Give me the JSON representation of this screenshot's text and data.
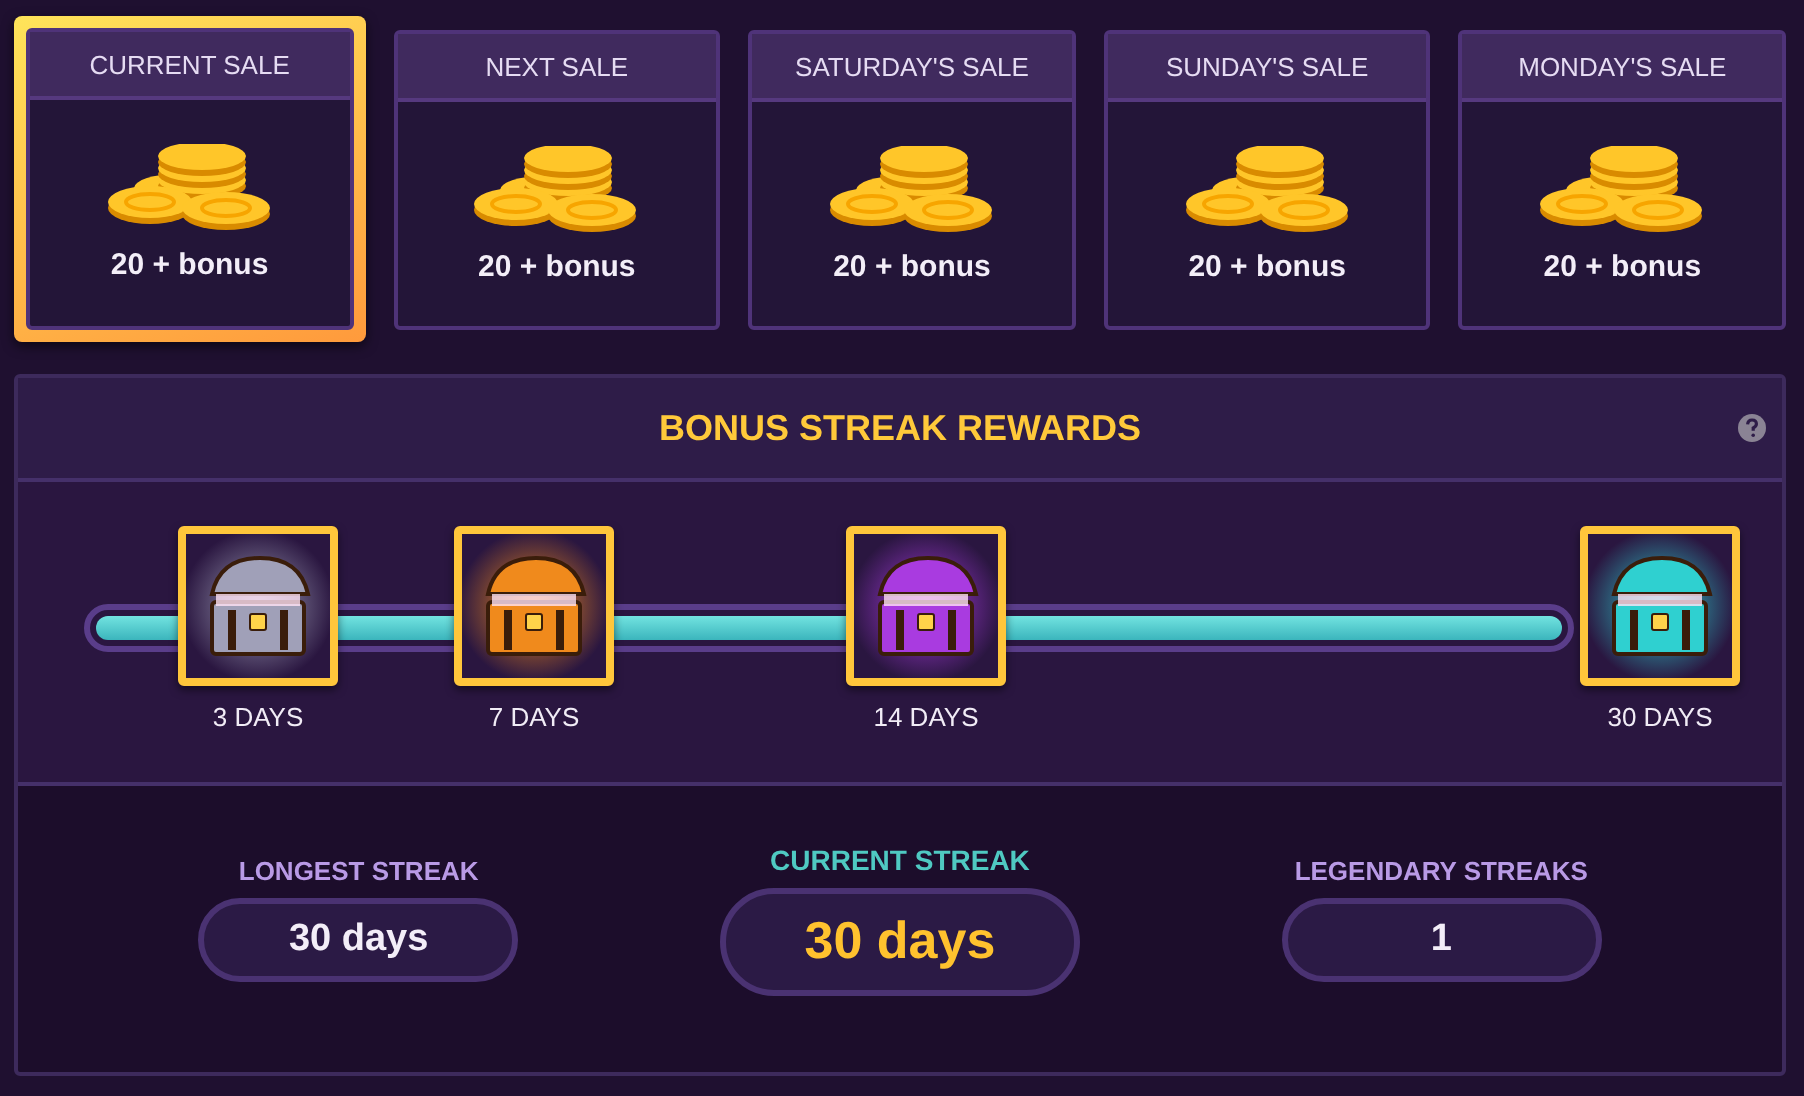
{
  "sales": [
    {
      "title": "CURRENT SALE",
      "amount": "20 + bonus",
      "selected": true
    },
    {
      "title": "NEXT SALE",
      "amount": "20 + bonus",
      "selected": false
    },
    {
      "title": "SATURDAY'S SALE",
      "amount": "20 + bonus",
      "selected": false
    },
    {
      "title": "SUNDAY'S SALE",
      "amount": "20 + bonus",
      "selected": false
    },
    {
      "title": "MONDAY'S SALE",
      "amount": "20 + bonus",
      "selected": false
    }
  ],
  "streak_panel": {
    "title": "BONUS STREAK REWARDS",
    "progress": {
      "level": 1
    },
    "milestones": [
      {
        "label": "3 DAYS",
        "color": "#a0a0b8"
      },
      {
        "label": "7 DAYS",
        "color": "#f08a1c"
      },
      {
        "label": "14 DAYS",
        "color": "#a93be0"
      },
      {
        "label": "30 DAYS",
        "color": "#2fd0d0"
      }
    ],
    "stats": [
      {
        "label": "LONGEST STREAK",
        "value": "30 days",
        "highlighted": false
      },
      {
        "label": "CURRENT STREAK",
        "value": "30 days",
        "highlighted": true
      },
      {
        "label": "LEGENDARY STREAKS",
        "value": "1",
        "highlighted": false
      }
    ]
  }
}
